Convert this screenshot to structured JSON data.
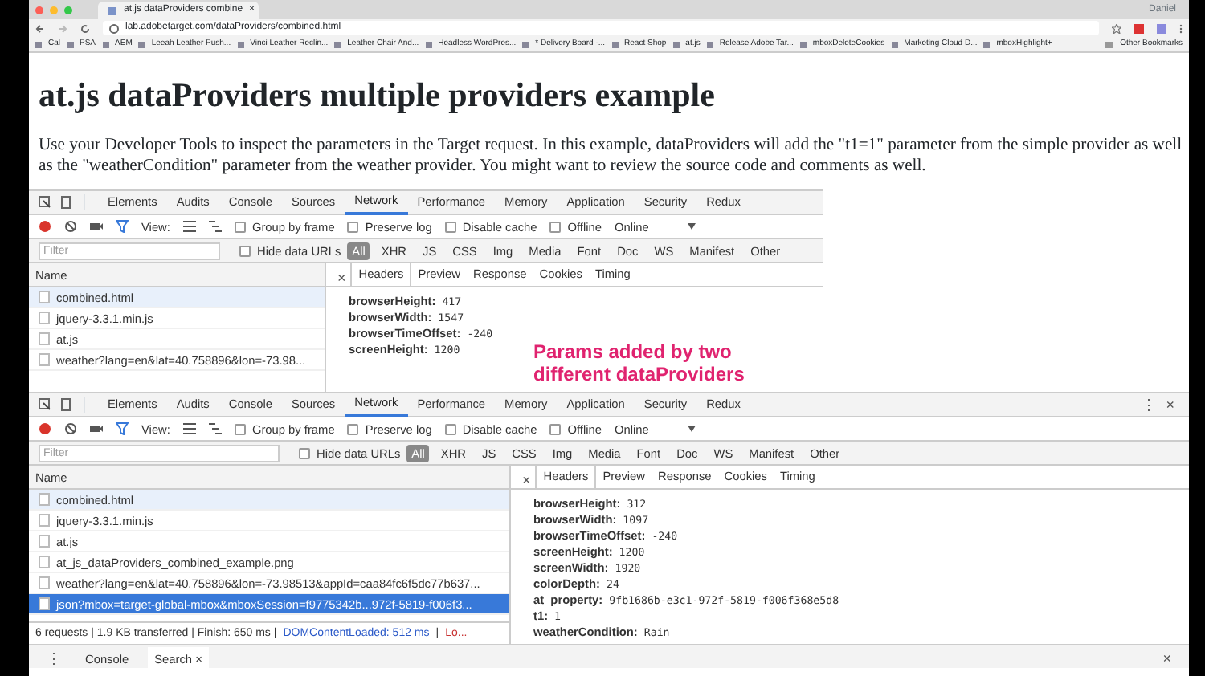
{
  "browser": {
    "tab": {
      "title": "at.js dataProviders combine",
      "close": "×"
    },
    "user": "Daniel",
    "url": "lab.adobetarget.com/dataProviders/combined.html",
    "bookmarks": [
      "Cal",
      "PSA",
      "AEM",
      "Leeah Leather Push...",
      "Vinci Leather Reclin...",
      "Leather Chair And...",
      "Headless WordPres...",
      "* Delivery Board -...",
      "React Shop",
      "at.js",
      "Release Adobe Tar...",
      "mboxDeleteCookies",
      "Marketing Cloud D...",
      "mboxHighlight+"
    ],
    "other_bookmarks": "Other Bookmarks"
  },
  "page": {
    "heading": "at.js dataProviders multiple providers example",
    "paragraph": "Use your Developer Tools to inspect the parameters in the Target request. In this example, dataProviders will add the \"t1=1\" parameter from the simple provider as well as the \"weatherCondition\" parameter from the weather provider. You might want to review the source code and comments as well."
  },
  "devtools": [
    {
      "panel_tabs": [
        {
          "label": "Elements",
          "selected": false
        },
        {
          "label": "Audits",
          "selected": false
        },
        {
          "label": "Console",
          "selected": false
        },
        {
          "label": "Sources",
          "selected": false
        },
        {
          "label": "Network",
          "selected": true
        },
        {
          "label": "Performance",
          "selected": false
        },
        {
          "label": "Memory",
          "selected": false
        },
        {
          "label": "Application",
          "selected": false
        },
        {
          "label": "Security",
          "selected": false
        },
        {
          "label": "Redux",
          "selected": false
        }
      ],
      "toolbar": {
        "view_label": "View:",
        "options": [
          {
            "label": "Group by frame",
            "checked": false
          },
          {
            "label": "Preserve log",
            "checked": false
          },
          {
            "label": "Disable cache",
            "checked": false
          },
          {
            "label": "Offline",
            "checked": false
          }
        ],
        "throttle": "Online"
      },
      "filter": {
        "placeholder": "Filter",
        "hide_data_urls": {
          "label": "Hide data URLs",
          "checked": false
        },
        "types": [
          {
            "label": "All",
            "selected": true
          },
          {
            "label": "XHR",
            "selected": false
          },
          {
            "label": "JS",
            "selected": false
          },
          {
            "label": "CSS",
            "selected": false
          },
          {
            "label": "Img",
            "selected": false
          },
          {
            "label": "Media",
            "selected": false
          },
          {
            "label": "Font",
            "selected": false
          },
          {
            "label": "Doc",
            "selected": false
          },
          {
            "label": "WS",
            "selected": false
          },
          {
            "label": "Manifest",
            "selected": false
          },
          {
            "label": "Other",
            "selected": false
          }
        ]
      },
      "name_header": "Name",
      "detail_close": "×",
      "detail_tabs": [
        {
          "label": "Headers",
          "selected": true
        },
        {
          "label": "Preview",
          "selected": false
        },
        {
          "label": "Response",
          "selected": false
        },
        {
          "label": "Cookies",
          "selected": false
        },
        {
          "label": "Timing",
          "selected": false
        }
      ],
      "requests": [
        {
          "name": "combined.html",
          "selected": false,
          "highlighted": true
        },
        {
          "name": "jquery-3.3.1.min.js",
          "selected": false,
          "highlighted": false
        },
        {
          "name": "at.js",
          "selected": false,
          "highlighted": false
        },
        {
          "name": "weather?lang=en&lat=40.758896&lon=-73.98...",
          "selected": false,
          "highlighted": false
        }
      ],
      "params": [
        {
          "key": "browserHeight:",
          "value": "417"
        },
        {
          "key": "browserWidth:",
          "value": "1547"
        },
        {
          "key": "browserTimeOffset:",
          "value": "-240"
        },
        {
          "key": "screenHeight:",
          "value": "1200"
        }
      ],
      "annotation": "Params added by two different dataProviders"
    },
    {
      "panel_tabs": [
        {
          "label": "Elements",
          "selected": false
        },
        {
          "label": "Audits",
          "selected": false
        },
        {
          "label": "Console",
          "selected": false
        },
        {
          "label": "Sources",
          "selected": false
        },
        {
          "label": "Network",
          "selected": true
        },
        {
          "label": "Performance",
          "selected": false
        },
        {
          "label": "Memory",
          "selected": false
        },
        {
          "label": "Application",
          "selected": false
        },
        {
          "label": "Security",
          "selected": false
        },
        {
          "label": "Redux",
          "selected": false
        }
      ],
      "window_controls": {
        "menu": "⋮",
        "close": "×"
      },
      "toolbar": {
        "view_label": "View:",
        "options": [
          {
            "label": "Group by frame",
            "checked": false
          },
          {
            "label": "Preserve log",
            "checked": false
          },
          {
            "label": "Disable cache",
            "checked": false
          },
          {
            "label": "Offline",
            "checked": false
          }
        ],
        "throttle": "Online"
      },
      "filter": {
        "placeholder": "Filter",
        "hide_data_urls": {
          "label": "Hide data URLs",
          "checked": false
        },
        "types": [
          {
            "label": "All",
            "selected": true
          },
          {
            "label": "XHR",
            "selected": false
          },
          {
            "label": "JS",
            "selected": false
          },
          {
            "label": "CSS",
            "selected": false
          },
          {
            "label": "Img",
            "selected": false
          },
          {
            "label": "Media",
            "selected": false
          },
          {
            "label": "Font",
            "selected": false
          },
          {
            "label": "Doc",
            "selected": false
          },
          {
            "label": "WS",
            "selected": false
          },
          {
            "label": "Manifest",
            "selected": false
          },
          {
            "label": "Other",
            "selected": false
          }
        ]
      },
      "name_header": "Name",
      "detail_close": "×",
      "detail_tabs": [
        {
          "label": "Headers",
          "selected": true
        },
        {
          "label": "Preview",
          "selected": false
        },
        {
          "label": "Response",
          "selected": false
        },
        {
          "label": "Cookies",
          "selected": false
        },
        {
          "label": "Timing",
          "selected": false
        }
      ],
      "requests": [
        {
          "name": "combined.html",
          "selected": false,
          "highlighted": true
        },
        {
          "name": "jquery-3.3.1.min.js",
          "selected": false,
          "highlighted": false
        },
        {
          "name": "at.js",
          "selected": false,
          "highlighted": false
        },
        {
          "name": "at_js_dataProviders_combined_example.png",
          "selected": false,
          "highlighted": false
        },
        {
          "name": "weather?lang=en&lat=40.758896&lon=-73.98513&appId=caa84fc6f5dc77b637...",
          "selected": false,
          "highlighted": false
        },
        {
          "name": "json?mbox=target-global-mbox&mboxSession=f9775342b...972f-5819-f006f3...",
          "selected": true,
          "highlighted": false
        }
      ],
      "status": [
        {
          "text": "6 requests | 1.9 KB transferred | Finish: 650 ms |",
          "kind": "plain"
        },
        {
          "text": "DOMContentLoaded: 512 ms",
          "kind": "dom"
        },
        {
          "text": "|",
          "kind": "plain"
        },
        {
          "text": "Lo...",
          "kind": "load"
        }
      ],
      "params": [
        {
          "key": "browserHeight:",
          "value": "312"
        },
        {
          "key": "browserWidth:",
          "value": "1097"
        },
        {
          "key": "browserTimeOffset:",
          "value": "-240"
        },
        {
          "key": "screenHeight:",
          "value": "1200"
        },
        {
          "key": "screenWidth:",
          "value": "1920"
        },
        {
          "key": "colorDepth:",
          "value": "24"
        },
        {
          "key": "at_property:",
          "value": "9fb1686b-e3c1-972f-5819-f006f368e5d8"
        },
        {
          "key": "t1:",
          "value": "1"
        },
        {
          "key": "weatherCondition:",
          "value": "Rain"
        }
      ],
      "drawer": {
        "menu": "⋮",
        "tabs": [
          {
            "label": "Console",
            "selected": false
          },
          {
            "label": "Search",
            "selected": true,
            "close": "×"
          }
        ],
        "close": "×"
      }
    }
  ]
}
